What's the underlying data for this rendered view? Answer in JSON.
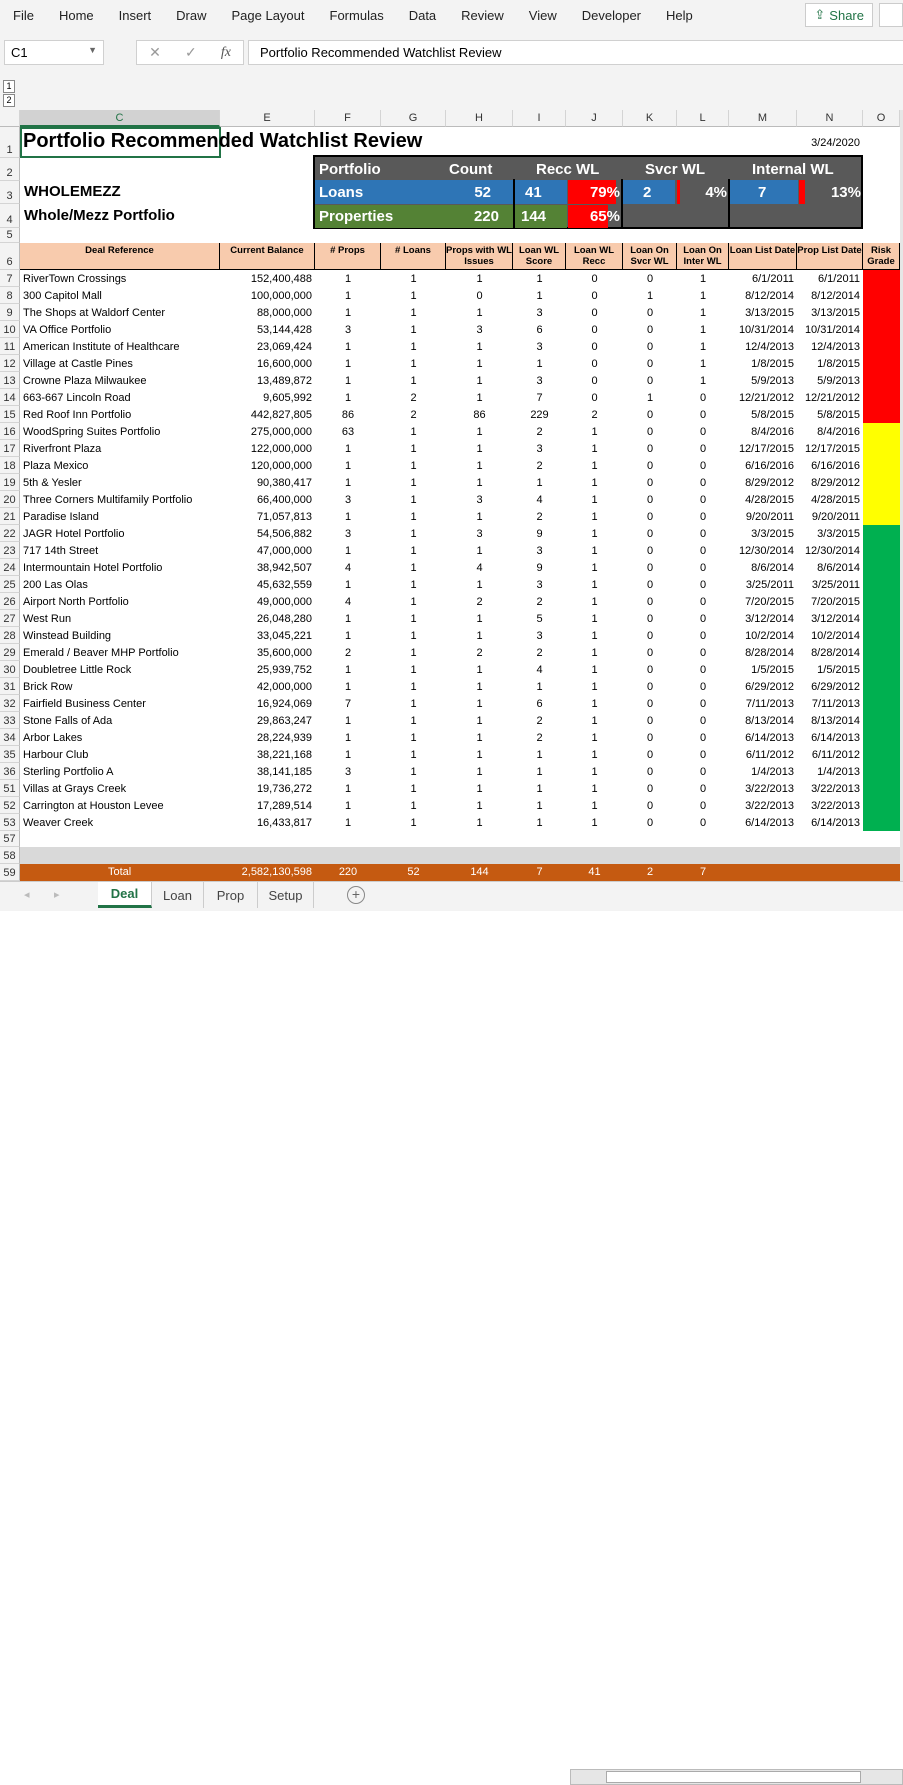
{
  "ribbon": {
    "tabs": [
      "File",
      "Home",
      "Insert",
      "Draw",
      "Page Layout",
      "Formulas",
      "Data",
      "Review",
      "View",
      "Developer",
      "Help"
    ],
    "share_label": "Share"
  },
  "formula_bar": {
    "name_box": "C1",
    "fx": "fx",
    "value": "Portfolio Recommended Watchlist Review"
  },
  "outline_levels": [
    "1",
    "2"
  ],
  "columns": [
    "C",
    "E",
    "F",
    "G",
    "H",
    "I",
    "J",
    "K",
    "L",
    "M",
    "N",
    "O"
  ],
  "sheet": {
    "title": "Portfolio Recommended Watchlist Review",
    "date": "3/24/2020",
    "entity": "WHOLEMEZZ",
    "portfolio_name": "Whole/Mezz Portfolio",
    "summary": {
      "headers": [
        "Portfolio",
        "Count",
        "Recc WL",
        "Svcr WL",
        "Internal WL"
      ],
      "loans": {
        "label": "Loans",
        "count": "52",
        "recc": "41",
        "recc_pct": "79%",
        "recc_fill": 0.79,
        "svcr": "2",
        "svcr_pct": "4%",
        "svcr_fill": 0.04,
        "inter": "7",
        "inter_pct": "13%",
        "inter_fill": 0.13
      },
      "properties": {
        "label": "Properties",
        "count": "220",
        "recc": "144",
        "recc_pct": "65%",
        "recc_fill": 0.65
      }
    },
    "headers": [
      "Deal Reference",
      "Current Balance",
      "# Props",
      "# Loans",
      "Props with WL Issues",
      "Loan WL Score",
      "Loan WL Recc",
      "Loan On Svcr WL",
      "Loan On Inter WL",
      "Loan List Date",
      "Prop List Date",
      "Risk Grade"
    ],
    "risk_colors": {
      "red": "#ff0000",
      "yellow": "#ffff00",
      "green": "#00b050"
    },
    "rows": [
      [
        "7",
        "RiverTown Crossings",
        "152,400,488",
        "1",
        "1",
        "1",
        "1",
        "0",
        "0",
        "1",
        "6/1/2011",
        "6/1/2011",
        "red"
      ],
      [
        "8",
        "300 Capitol Mall",
        "100,000,000",
        "1",
        "1",
        "0",
        "1",
        "0",
        "1",
        "1",
        "8/12/2014",
        "8/12/2014",
        "red"
      ],
      [
        "9",
        "The Shops at Waldorf Center",
        "88,000,000",
        "1",
        "1",
        "1",
        "3",
        "0",
        "0",
        "1",
        "3/13/2015",
        "3/13/2015",
        "red"
      ],
      [
        "10",
        "VA Office Portfolio",
        "53,144,428",
        "3",
        "1",
        "3",
        "6",
        "0",
        "0",
        "1",
        "10/31/2014",
        "10/31/2014",
        "red"
      ],
      [
        "11",
        "American Institute of Healthcare",
        "23,069,424",
        "1",
        "1",
        "1",
        "3",
        "0",
        "0",
        "1",
        "12/4/2013",
        "12/4/2013",
        "red"
      ],
      [
        "12",
        "Village at Castle Pines",
        "16,600,000",
        "1",
        "1",
        "1",
        "1",
        "0",
        "0",
        "1",
        "1/8/2015",
        "1/8/2015",
        "red"
      ],
      [
        "13",
        "Crowne Plaza Milwaukee",
        "13,489,872",
        "1",
        "1",
        "1",
        "3",
        "0",
        "0",
        "1",
        "5/9/2013",
        "5/9/2013",
        "red"
      ],
      [
        "14",
        "663-667 Lincoln Road",
        "9,605,992",
        "1",
        "2",
        "1",
        "7",
        "0",
        "1",
        "0",
        "12/21/2012",
        "12/21/2012",
        "red"
      ],
      [
        "15",
        "Red Roof Inn Portfolio",
        "442,827,805",
        "86",
        "2",
        "86",
        "229",
        "2",
        "0",
        "0",
        "5/8/2015",
        "5/8/2015",
        "red"
      ],
      [
        "16",
        "WoodSpring Suites Portfolio",
        "275,000,000",
        "63",
        "1",
        "1",
        "2",
        "1",
        "0",
        "0",
        "8/4/2016",
        "8/4/2016",
        "yellow"
      ],
      [
        "17",
        "Riverfront Plaza",
        "122,000,000",
        "1",
        "1",
        "1",
        "3",
        "1",
        "0",
        "0",
        "12/17/2015",
        "12/17/2015",
        "yellow"
      ],
      [
        "18",
        "Plaza Mexico",
        "120,000,000",
        "1",
        "1",
        "1",
        "2",
        "1",
        "0",
        "0",
        "6/16/2016",
        "6/16/2016",
        "yellow"
      ],
      [
        "19",
        "5th & Yesler",
        "90,380,417",
        "1",
        "1",
        "1",
        "1",
        "1",
        "0",
        "0",
        "8/29/2012",
        "8/29/2012",
        "yellow"
      ],
      [
        "20",
        "Three Corners Multifamily Portfolio",
        "66,400,000",
        "3",
        "1",
        "3",
        "4",
        "1",
        "0",
        "0",
        "4/28/2015",
        "4/28/2015",
        "yellow"
      ],
      [
        "21",
        "Paradise Island",
        "71,057,813",
        "1",
        "1",
        "1",
        "2",
        "1",
        "0",
        "0",
        "9/20/2011",
        "9/20/2011",
        "yellow"
      ],
      [
        "22",
        "JAGR Hotel Portfolio",
        "54,506,882",
        "3",
        "1",
        "3",
        "9",
        "1",
        "0",
        "0",
        "3/3/2015",
        "3/3/2015",
        "green"
      ],
      [
        "23",
        "717 14th Street",
        "47,000,000",
        "1",
        "1",
        "1",
        "3",
        "1",
        "0",
        "0",
        "12/30/2014",
        "12/30/2014",
        "green"
      ],
      [
        "24",
        "Intermountain Hotel Portfolio",
        "38,942,507",
        "4",
        "1",
        "4",
        "9",
        "1",
        "0",
        "0",
        "8/6/2014",
        "8/6/2014",
        "green"
      ],
      [
        "25",
        "200 Las Olas",
        "45,632,559",
        "1",
        "1",
        "1",
        "3",
        "1",
        "0",
        "0",
        "3/25/2011",
        "3/25/2011",
        "green"
      ],
      [
        "26",
        "Airport North Portfolio",
        "49,000,000",
        "4",
        "1",
        "2",
        "2",
        "1",
        "0",
        "0",
        "7/20/2015",
        "7/20/2015",
        "green"
      ],
      [
        "27",
        "West Run",
        "26,048,280",
        "1",
        "1",
        "1",
        "5",
        "1",
        "0",
        "0",
        "3/12/2014",
        "3/12/2014",
        "green"
      ],
      [
        "28",
        "Winstead Building",
        "33,045,221",
        "1",
        "1",
        "1",
        "3",
        "1",
        "0",
        "0",
        "10/2/2014",
        "10/2/2014",
        "green"
      ],
      [
        "29",
        "Emerald / Beaver MHP Portfolio",
        "35,600,000",
        "2",
        "1",
        "2",
        "2",
        "1",
        "0",
        "0",
        "8/28/2014",
        "8/28/2014",
        "green"
      ],
      [
        "30",
        "Doubletree Little Rock",
        "25,939,752",
        "1",
        "1",
        "1",
        "4",
        "1",
        "0",
        "0",
        "1/5/2015",
        "1/5/2015",
        "green"
      ],
      [
        "31",
        "Brick Row",
        "42,000,000",
        "1",
        "1",
        "1",
        "1",
        "1",
        "0",
        "0",
        "6/29/2012",
        "6/29/2012",
        "green"
      ],
      [
        "32",
        "Fairfield Business Center",
        "16,924,069",
        "7",
        "1",
        "1",
        "6",
        "1",
        "0",
        "0",
        "7/11/2013",
        "7/11/2013",
        "green"
      ],
      [
        "33",
        "Stone Falls of Ada",
        "29,863,247",
        "1",
        "1",
        "1",
        "2",
        "1",
        "0",
        "0",
        "8/13/2014",
        "8/13/2014",
        "green"
      ],
      [
        "34",
        "Arbor Lakes",
        "28,224,939",
        "1",
        "1",
        "1",
        "2",
        "1",
        "0",
        "0",
        "6/14/2013",
        "6/14/2013",
        "green"
      ],
      [
        "35",
        "Harbour Club",
        "38,221,168",
        "1",
        "1",
        "1",
        "1",
        "1",
        "0",
        "0",
        "6/11/2012",
        "6/11/2012",
        "green"
      ],
      [
        "36",
        "Sterling Portfolio A",
        "38,141,185",
        "3",
        "1",
        "1",
        "1",
        "1",
        "0",
        "0",
        "1/4/2013",
        "1/4/2013",
        "green"
      ],
      [
        "51",
        "Villas at Grays Creek",
        "19,736,272",
        "1",
        "1",
        "1",
        "1",
        "1",
        "0",
        "0",
        "3/22/2013",
        "3/22/2013",
        "green"
      ],
      [
        "52",
        "Carrington at Houston Levee",
        "17,289,514",
        "1",
        "1",
        "1",
        "1",
        "1",
        "0",
        "0",
        "3/22/2013",
        "3/22/2013",
        "green"
      ],
      [
        "53",
        "Weaver Creek",
        "16,433,817",
        "1",
        "1",
        "1",
        "1",
        "1",
        "0",
        "0",
        "6/14/2013",
        "6/14/2013",
        "green"
      ]
    ],
    "total": {
      "label": "Total",
      "balance": "2,582,130,598",
      "props": "220",
      "loans": "52",
      "props_wl": "144",
      "score": "7",
      "recc": "41",
      "svcr": "2",
      "inter": "7"
    },
    "row_numbers_top": [
      "1",
      "2",
      "3",
      "4",
      "5",
      "6"
    ],
    "row_numbers_bottom": [
      "57",
      "58",
      "59"
    ]
  },
  "sheet_tabs": [
    "Deal",
    "Loan",
    "Prop",
    "Setup"
  ],
  "active_tab": "Deal"
}
